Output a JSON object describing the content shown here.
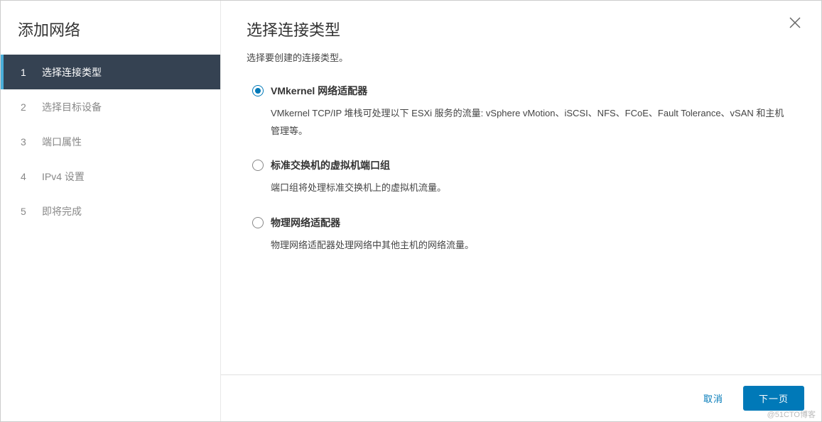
{
  "sidebar": {
    "title": "添加网络",
    "steps": [
      {
        "num": "1",
        "label": "选择连接类型",
        "active": true
      },
      {
        "num": "2",
        "label": "选择目标设备",
        "active": false
      },
      {
        "num": "3",
        "label": "端口属性",
        "active": false
      },
      {
        "num": "4",
        "label": "IPv4 设置",
        "active": false
      },
      {
        "num": "5",
        "label": "即将完成",
        "active": false
      }
    ]
  },
  "main": {
    "title": "选择连接类型",
    "subtitle": "选择要创建的连接类型。",
    "options": [
      {
        "label": "VMkernel 网络适配器",
        "description": "VMkernel TCP/IP 堆栈可处理以下 ESXi 服务的流量: vSphere vMotion、iSCSI、NFS、FCoE、Fault Tolerance、vSAN 和主机管理等。",
        "selected": true
      },
      {
        "label": "标准交换机的虚拟机端口组",
        "description": "端口组将处理标准交换机上的虚拟机流量。",
        "selected": false
      },
      {
        "label": "物理网络适配器",
        "description": "物理网络适配器处理网络中其他主机的网络流量。",
        "selected": false
      }
    ]
  },
  "footer": {
    "cancel": "取消",
    "next": "下一页"
  },
  "watermark": "@51CTO博客"
}
